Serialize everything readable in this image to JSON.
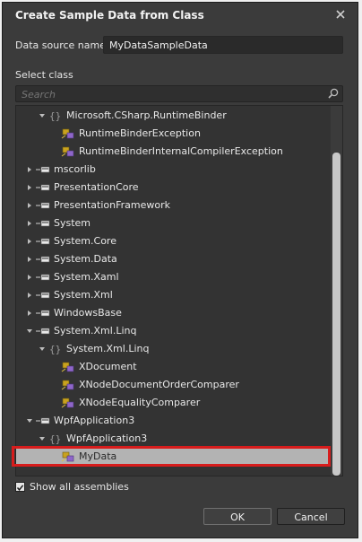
{
  "window": {
    "title": "Create Sample Data from Class",
    "close_glyph": "✕"
  },
  "form": {
    "data_source_label": "Data source name",
    "data_source_value": "MyDataSampleData",
    "select_class_label": "Select class",
    "search_placeholder": "Search",
    "show_all_label": "Show all assemblies",
    "show_all_checked": true
  },
  "tree": {
    "rows": [
      {
        "label": "Microsoft.CSharp.RuntimeBinder",
        "kind": "namespace",
        "expander": "expanded"
      },
      {
        "label": "RuntimeBinderException",
        "kind": "class",
        "expander": "none"
      },
      {
        "label": "RuntimeBinderInternalCompilerException",
        "kind": "class",
        "expander": "none"
      },
      {
        "label": "mscorlib",
        "kind": "assembly",
        "expander": "collapsed"
      },
      {
        "label": "PresentationCore",
        "kind": "assembly",
        "expander": "collapsed"
      },
      {
        "label": "PresentationFramework",
        "kind": "assembly",
        "expander": "collapsed"
      },
      {
        "label": "System",
        "kind": "assembly",
        "expander": "collapsed"
      },
      {
        "label": "System.Core",
        "kind": "assembly",
        "expander": "collapsed"
      },
      {
        "label": "System.Data",
        "kind": "assembly",
        "expander": "collapsed"
      },
      {
        "label": "System.Xaml",
        "kind": "assembly",
        "expander": "collapsed"
      },
      {
        "label": "System.Xml",
        "kind": "assembly",
        "expander": "collapsed"
      },
      {
        "label": "WindowsBase",
        "kind": "assembly",
        "expander": "collapsed"
      },
      {
        "label": "System.Xml.Linq",
        "kind": "assembly",
        "expander": "expanded"
      },
      {
        "label": "System.Xml.Linq",
        "kind": "namespace",
        "expander": "expanded"
      },
      {
        "label": "XDocument",
        "kind": "class",
        "expander": "none"
      },
      {
        "label": "XNodeDocumentOrderComparer",
        "kind": "class",
        "expander": "none"
      },
      {
        "label": "XNodeEqualityComparer",
        "kind": "class",
        "expander": "none"
      },
      {
        "label": "WpfApplication3",
        "kind": "assembly",
        "expander": "expanded"
      },
      {
        "label": "WpfApplication3",
        "kind": "namespace",
        "expander": "expanded"
      },
      {
        "label": "MyData",
        "kind": "class",
        "expander": "none",
        "selected": true
      }
    ]
  },
  "buttons": {
    "ok": "OK",
    "cancel": "Cancel"
  },
  "colors": {
    "dialog_bg": "#3b3b3b",
    "selection": "#b3b3b3",
    "highlight_border": "#d71c1c"
  }
}
